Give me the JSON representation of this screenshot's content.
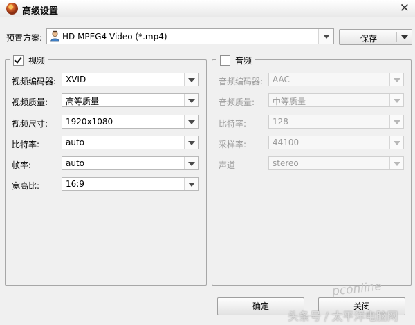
{
  "window": {
    "title": "高级设置",
    "close_glyph": "✕"
  },
  "icons": {
    "app": "app-logo-icon",
    "preset": "person-profile-icon",
    "dropdown": "chevron-down-icon"
  },
  "preset": {
    "label": "预置方案:",
    "value": "HD MPEG4 Video (*.mp4)"
  },
  "save": {
    "label": "保存"
  },
  "video": {
    "title": "视频",
    "enabled": true,
    "fields": [
      {
        "label": "视频编码器:",
        "value": "XVID"
      },
      {
        "label": "视频质量:",
        "value": "高等质量"
      },
      {
        "label": "视频尺寸:",
        "value": "1920x1080"
      },
      {
        "label": "比特率:",
        "value": "auto"
      },
      {
        "label": "帧率:",
        "value": "auto"
      },
      {
        "label": "宽高比:",
        "value": "16:9"
      }
    ]
  },
  "audio": {
    "title": "音频",
    "enabled": false,
    "fields": [
      {
        "label": "音频编码器:",
        "value": "AAC"
      },
      {
        "label": "音频质量:",
        "value": "中等质量"
      },
      {
        "label": "比特率:",
        "value": "128"
      },
      {
        "label": "采样率:",
        "value": "44100"
      },
      {
        "label": "声道",
        "value": "stereo"
      }
    ]
  },
  "buttons": {
    "ok": "确定",
    "close": "关闭"
  },
  "watermark": {
    "logo": "pconline",
    "text": "头条号 / 太平洋电脑网"
  }
}
